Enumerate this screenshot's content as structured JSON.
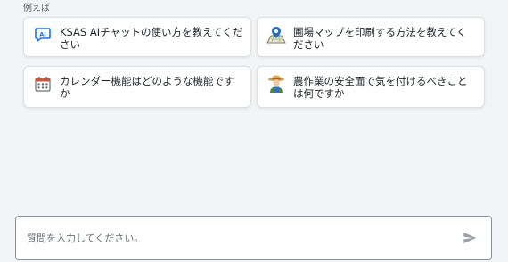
{
  "examples": {
    "heading": "例えば",
    "cards": [
      {
        "label": "KSAS AIチャットの使い方を教えてください",
        "icon": "ai-chat-icon"
      },
      {
        "label": "圃場マップを印刷する方法を教えてください",
        "icon": "map-pin-icon"
      },
      {
        "label": "カレンダー機能はどのような機能ですか",
        "icon": "calendar-icon"
      },
      {
        "label": "農作業の安全面で気を付けるべきことは何ですか",
        "icon": "farmer-icon"
      }
    ]
  },
  "chat_input": {
    "placeholder": "質問を入力してください。",
    "value": "",
    "send_icon": "send-icon"
  },
  "colors": {
    "background": "#f3f4f6",
    "ai_icon_blue": "#1a73e8",
    "send_icon_gray": "#9aa0a6"
  }
}
